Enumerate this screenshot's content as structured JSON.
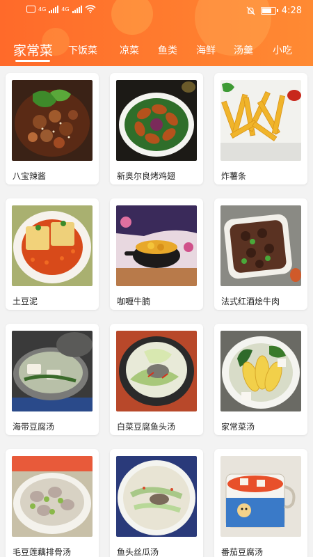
{
  "status": {
    "time": "4:28",
    "sim1": "4G",
    "sim2": "4G",
    "battery_level": 0.8,
    "icons": [
      "sim-icon",
      "signal-icon",
      "wifi-icon",
      "mute-icon",
      "battery-icon"
    ]
  },
  "tabs": [
    {
      "label": "家常菜",
      "active": true
    },
    {
      "label": "下饭菜",
      "active": false
    },
    {
      "label": "凉菜",
      "active": false
    },
    {
      "label": "鱼类",
      "active": false
    },
    {
      "label": "海鲜",
      "active": false
    },
    {
      "label": "汤羹",
      "active": false
    },
    {
      "label": "小吃",
      "active": false
    }
  ],
  "recipes": [
    {
      "name": "八宝辣酱"
    },
    {
      "name": "新奥尔良烤鸡翅"
    },
    {
      "name": "炸薯条"
    },
    {
      "name": "土豆泥"
    },
    {
      "name": "咖喱牛腩"
    },
    {
      "name": "法式红酒烩牛肉"
    },
    {
      "name": "海带豆腐汤"
    },
    {
      "name": "白菜豆腐鱼头汤"
    },
    {
      "name": "家常菜汤"
    },
    {
      "name": "毛豆莲藕排骨汤"
    },
    {
      "name": "鱼头丝瓜汤"
    },
    {
      "name": "番茄豆腐汤"
    }
  ],
  "colors": {
    "header": "#ff7a2e",
    "accent": "#ffffff",
    "background": "#f3f3f3"
  }
}
